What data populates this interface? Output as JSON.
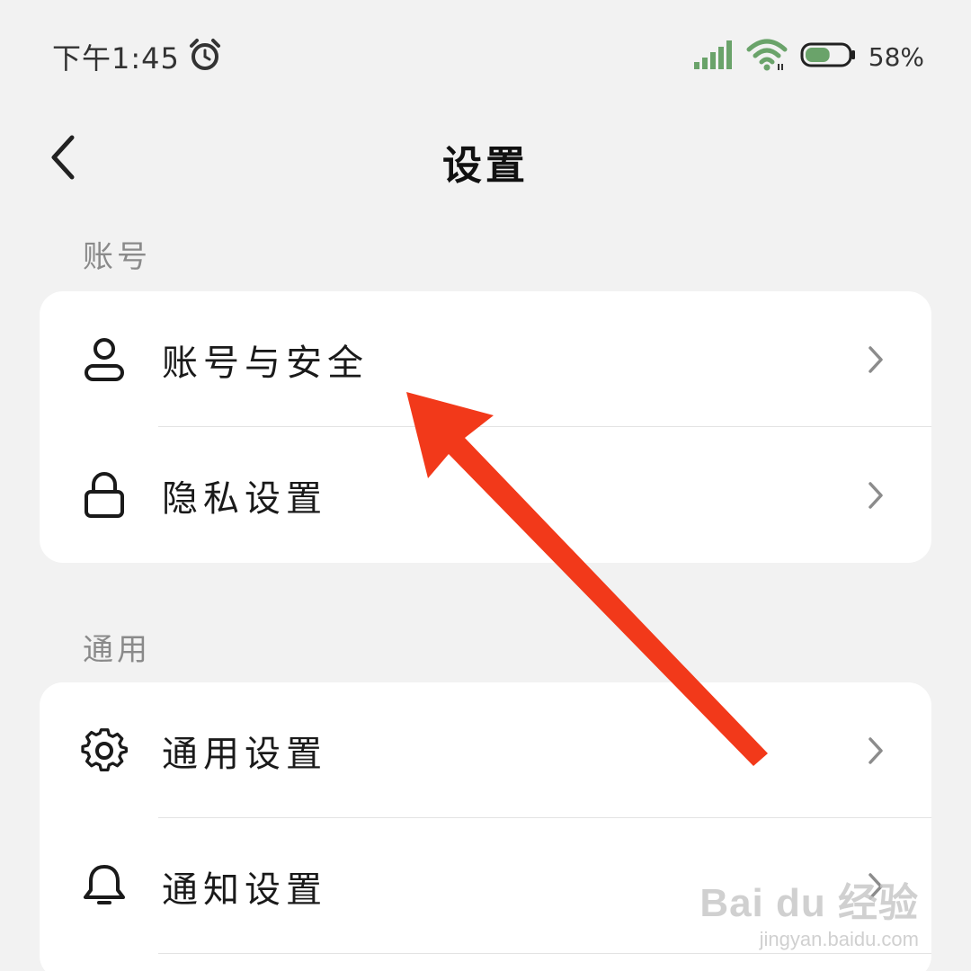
{
  "status_bar": {
    "time": "下午1:45",
    "battery_percent": "58%",
    "battery_level": 0.58,
    "alarm_icon": "alarm-clock-icon",
    "signal_icon": "cellular-signal-icon",
    "wifi_icon": "wifi-icon",
    "battery_icon": "battery-icon",
    "signal_color": "#6aa36a"
  },
  "header": {
    "title": "设置",
    "back_icon": "chevron-left-icon"
  },
  "sections": [
    {
      "title": "账号",
      "items": [
        {
          "label": "账号与安全",
          "icon": "user-icon"
        },
        {
          "label": "隐私设置",
          "icon": "lock-icon"
        }
      ]
    },
    {
      "title": "通用",
      "items": [
        {
          "label": "通用设置",
          "icon": "gear-icon"
        },
        {
          "label": "通知设置",
          "icon": "bell-icon"
        }
      ]
    }
  ],
  "annotation": {
    "color": "#f2391a",
    "icon": "red-arrow-annotation"
  },
  "watermark": {
    "main": "Bai du 经验",
    "sub": "jingyan.baidu.com"
  }
}
